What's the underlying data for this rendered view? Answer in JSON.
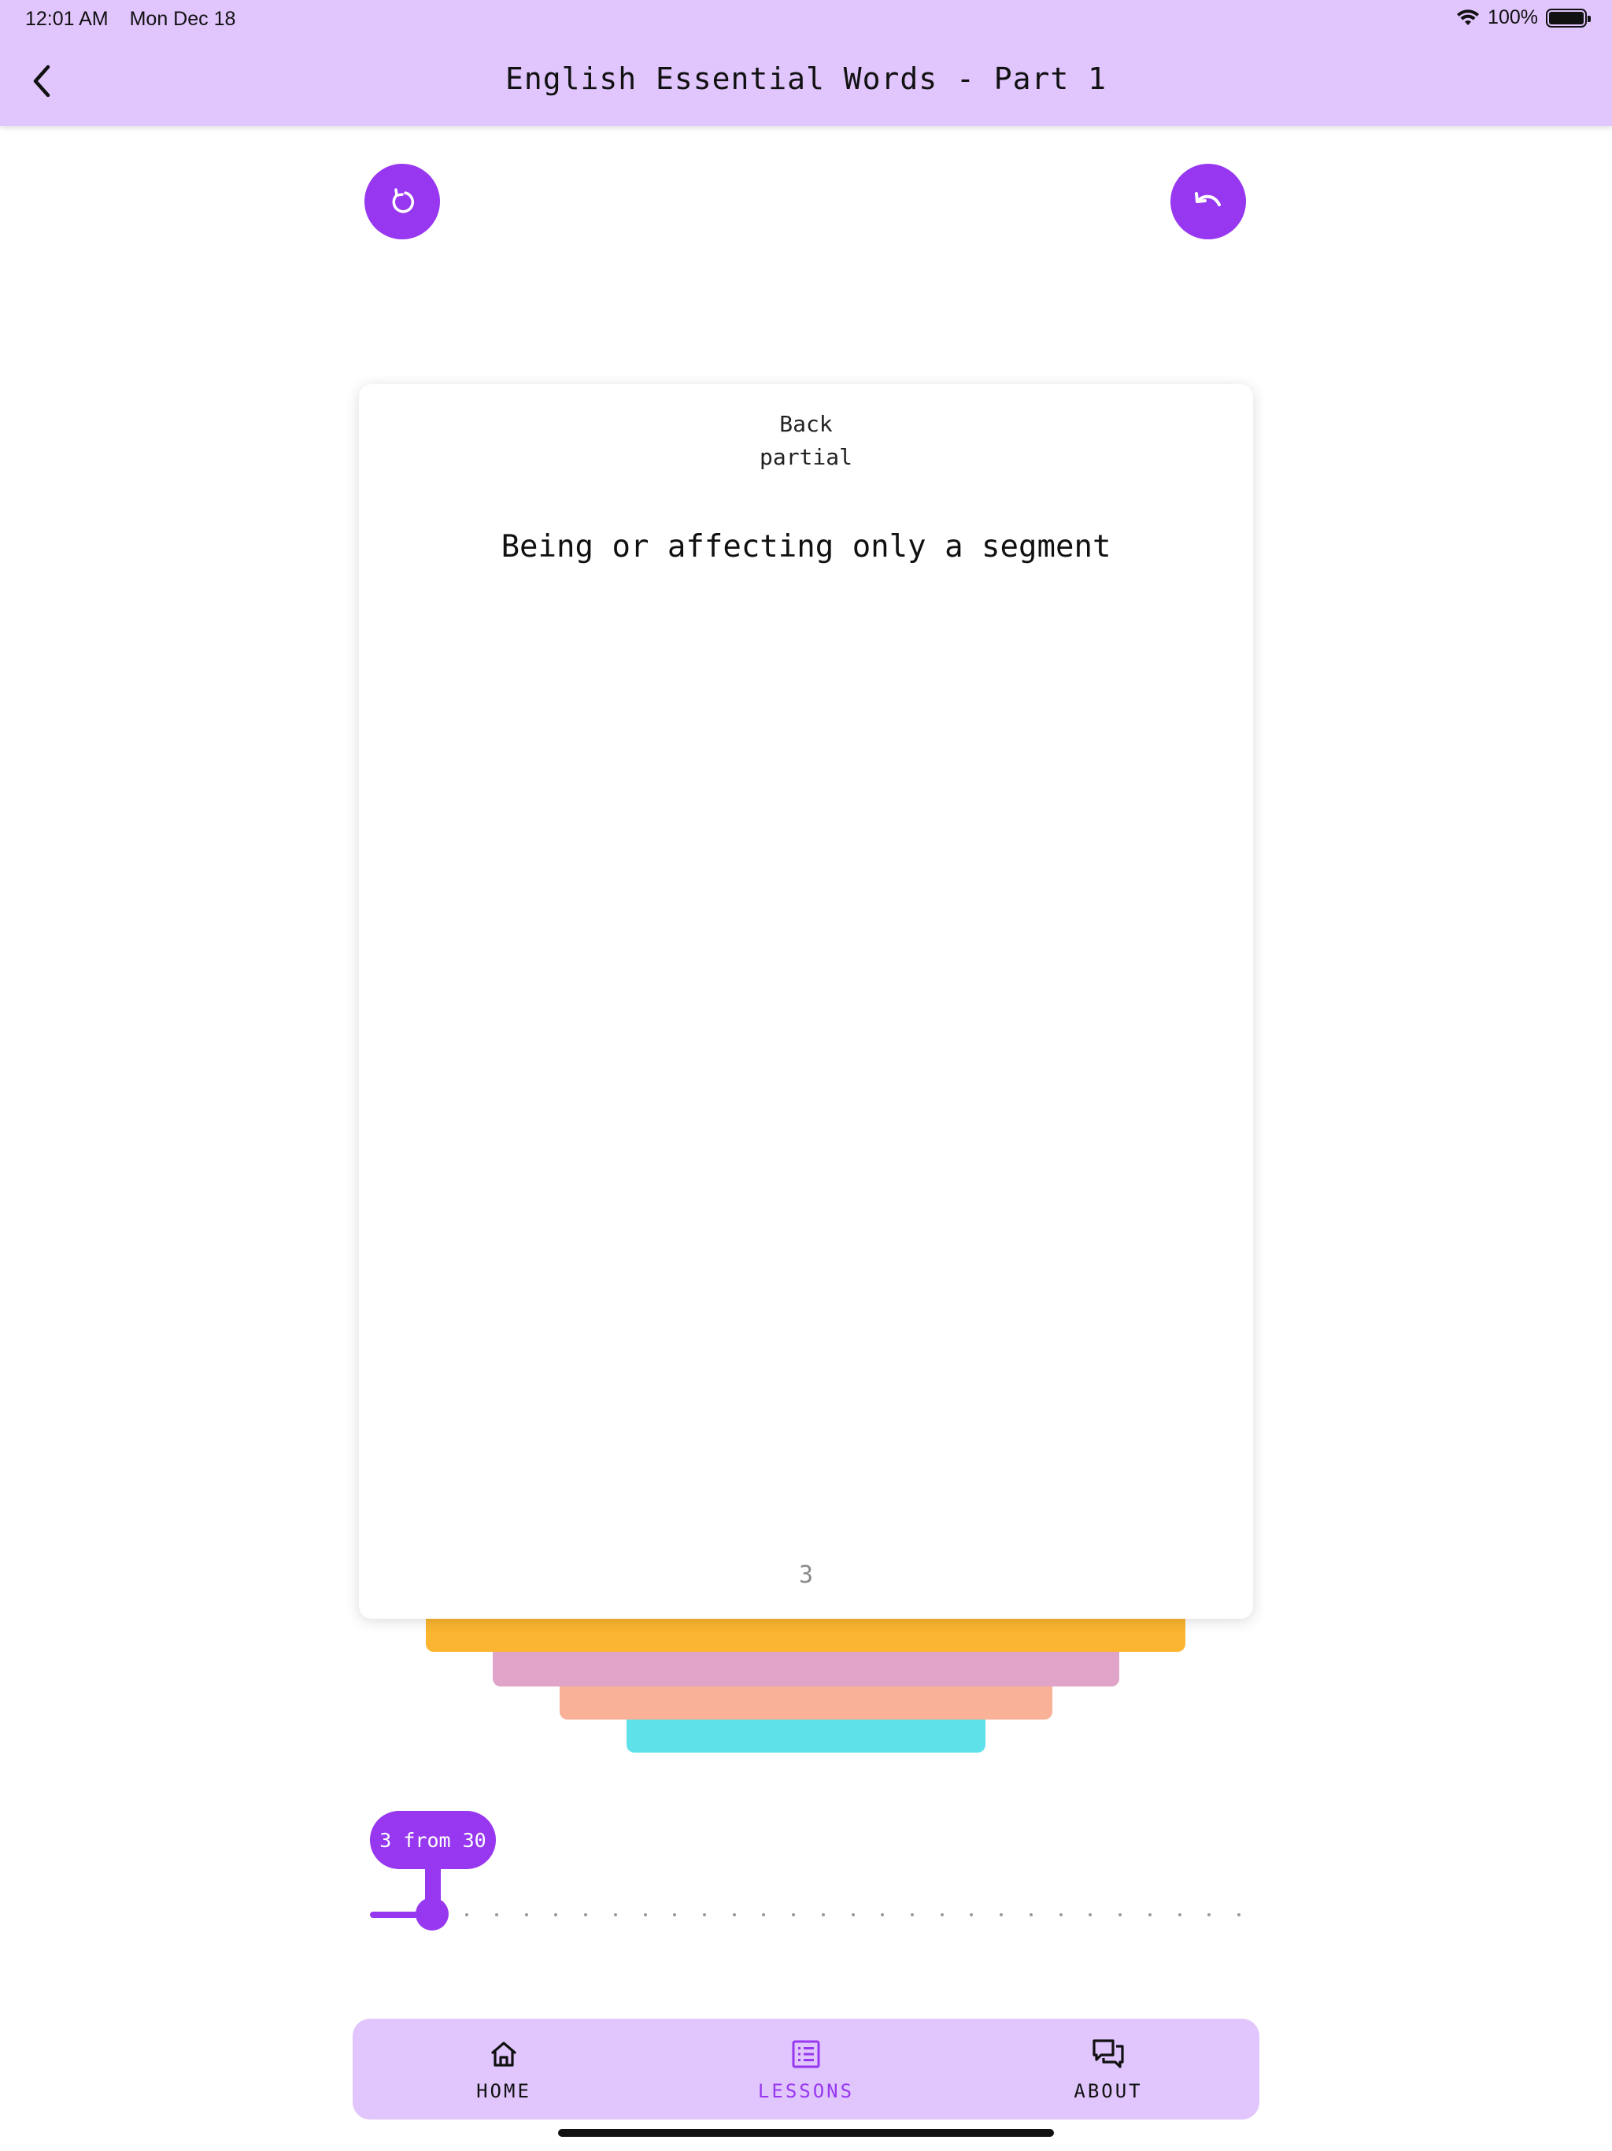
{
  "status_bar": {
    "time": "12:01 AM",
    "date": "Mon Dec 18",
    "battery": "100%"
  },
  "header": {
    "title": "English Essential Words - Part 1"
  },
  "actions": {
    "reset_icon": "refresh-icon",
    "undo_icon": "undo-icon"
  },
  "card": {
    "side": "Back",
    "word": "partial",
    "definition": "Being or affecting only a segment",
    "index": "3"
  },
  "slider": {
    "label": "3 from 30",
    "current": 3,
    "total": 30
  },
  "tabs": [
    {
      "label": "HOME",
      "icon": "home-icon"
    },
    {
      "label": "LESSONS",
      "icon": "list-icon",
      "active": true
    },
    {
      "label": "ABOUT",
      "icon": "chat-icon"
    }
  ],
  "colors": {
    "accent": "#9738f0",
    "bar": "#e1c5fd",
    "stack": [
      "#fbb530",
      "#e0a4c8",
      "#f9b197",
      "#5fe1ea"
    ]
  }
}
